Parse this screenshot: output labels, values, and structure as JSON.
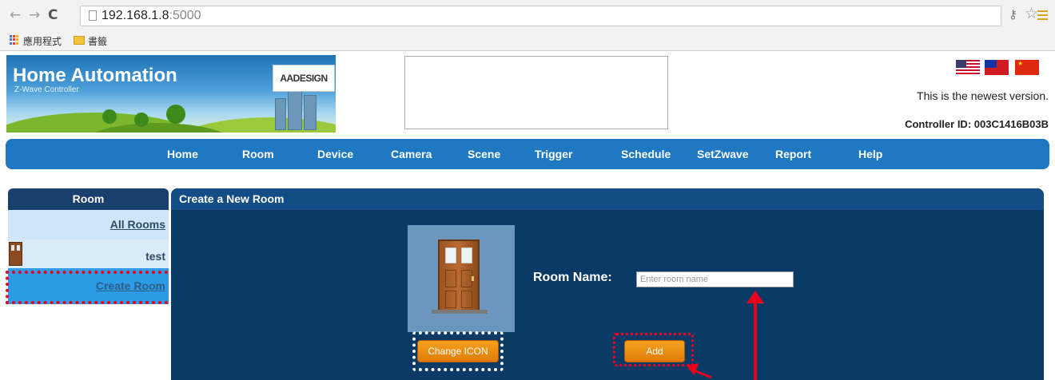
{
  "browser": {
    "url_host": "192.168.1.8",
    "url_port": ":5000",
    "bookmarks": {
      "apps_label": "應用程式",
      "folder_label": "書籤"
    }
  },
  "header": {
    "banner_title": "Home Automation",
    "banner_subtitle": "Z-Wave Controller",
    "logo_text": "AADESIGN",
    "version_text": "This is the newest version.",
    "controller_id": "Controller ID: 003C1416B03B"
  },
  "nav": {
    "items": [
      "Home",
      "Room",
      "Device",
      "Camera",
      "Scene",
      "Trigger",
      "Schedule",
      "SetZwave",
      "Report",
      "Help"
    ]
  },
  "sidebar": {
    "title": "Room",
    "all_rooms": "All Rooms",
    "room_test": "test",
    "create_room": "Create Room"
  },
  "panel": {
    "title": "Create a New Room",
    "change_icon_label": "Change ICON",
    "room_name_label": "Room Name:",
    "room_name_placeholder": "Enter room name",
    "add_label": "Add"
  },
  "colors": {
    "nav_blue": "#1e78c2",
    "panel_dark": "#0b3a66",
    "button_orange": "#f39517",
    "highlight_red": "#e8001c"
  }
}
